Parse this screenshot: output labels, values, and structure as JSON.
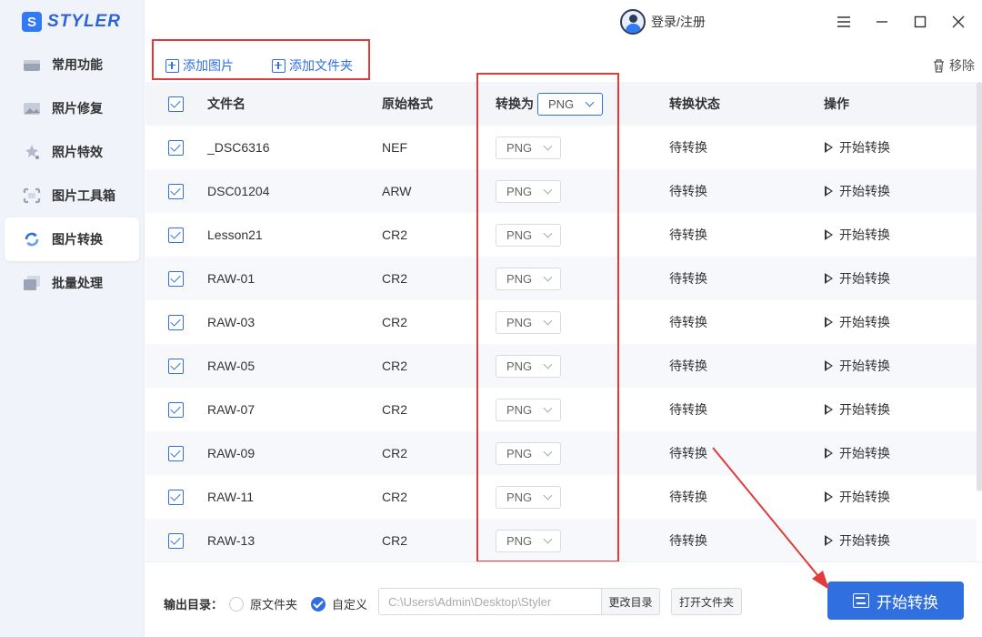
{
  "app": {
    "logo_letter": "S",
    "logo_text": "STYLER"
  },
  "sidebar": {
    "items": [
      {
        "label": "常用功能",
        "icon": "common-tools-icon",
        "active": false
      },
      {
        "label": "照片修复",
        "icon": "photo-repair-icon",
        "active": false
      },
      {
        "label": "照片特效",
        "icon": "photo-effects-icon",
        "active": false
      },
      {
        "label": "图片工具箱",
        "icon": "image-toolbox-icon",
        "active": false
      },
      {
        "label": "图片转换",
        "icon": "image-convert-icon",
        "active": true
      },
      {
        "label": "批量处理",
        "icon": "batch-process-icon",
        "active": false
      }
    ]
  },
  "topbar": {
    "login_label": "登录/注册"
  },
  "toolbar": {
    "add_image": "添加图片",
    "add_folder": "添加文件夹",
    "remove": "移除"
  },
  "table": {
    "headers": {
      "filename": "文件名",
      "format": "原始格式",
      "convert_to": "转换为",
      "status": "转换状态",
      "action": "操作"
    },
    "global_target": "PNG",
    "rows": [
      {
        "name": "_DSC6316",
        "format": "NEF",
        "target": "PNG",
        "status": "待转换",
        "action": "开始转换"
      },
      {
        "name": "DSC01204",
        "format": "ARW",
        "target": "PNG",
        "status": "待转换",
        "action": "开始转换"
      },
      {
        "name": "Lesson21",
        "format": "CR2",
        "target": "PNG",
        "status": "待转换",
        "action": "开始转换"
      },
      {
        "name": "RAW-01",
        "format": "CR2",
        "target": "PNG",
        "status": "待转换",
        "action": "开始转换"
      },
      {
        "name": "RAW-03",
        "format": "CR2",
        "target": "PNG",
        "status": "待转换",
        "action": "开始转换"
      },
      {
        "name": "RAW-05",
        "format": "CR2",
        "target": "PNG",
        "status": "待转换",
        "action": "开始转换"
      },
      {
        "name": "RAW-07",
        "format": "CR2",
        "target": "PNG",
        "status": "待转换",
        "action": "开始转换"
      },
      {
        "name": "RAW-09",
        "format": "CR2",
        "target": "PNG",
        "status": "待转换",
        "action": "开始转换"
      },
      {
        "name": "RAW-11",
        "format": "CR2",
        "target": "PNG",
        "status": "待转换",
        "action": "开始转换"
      },
      {
        "name": "RAW-13",
        "format": "CR2",
        "target": "PNG",
        "status": "待转换",
        "action": "开始转换"
      }
    ]
  },
  "output": {
    "label": "输出目录：",
    "option_original": "原文件夹",
    "option_custom": "自定义",
    "path": "C:\\Users\\Admin\\Desktop\\Styler",
    "change_dir": "更改目录",
    "open_folder": "打开文件夹",
    "start": "开始转换"
  },
  "colors": {
    "accent": "#2f6fe0",
    "annotation": "#e23b3b",
    "sidebar_bg": "#f0f3fa"
  }
}
